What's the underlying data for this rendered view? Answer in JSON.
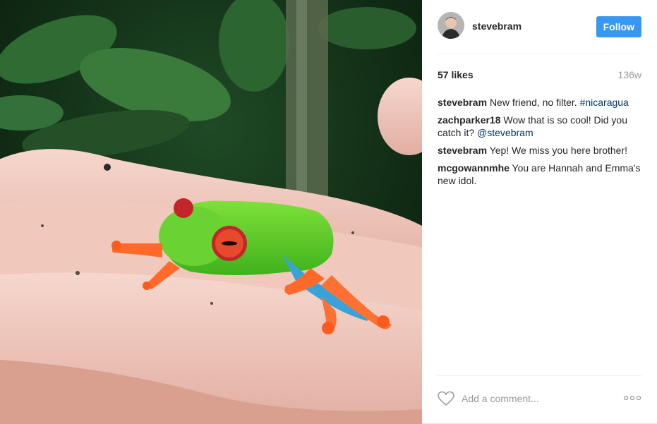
{
  "post": {
    "username": "stevebram",
    "follow_label": "Follow",
    "likes": "57 likes",
    "age": "136w"
  },
  "comments": [
    {
      "user": "stevebram",
      "text": "New friend, no filter. ",
      "link": "#nicaragua"
    },
    {
      "user": "zachparker18",
      "text": "Wow that is so cool! Did you catch it? ",
      "link": "@stevebram"
    },
    {
      "user": "stevebram",
      "text": "Yep! We miss you here brother!",
      "link": ""
    },
    {
      "user": "mcgowannmhe",
      "text": "You are Hannah and Emma's new idol.",
      "link": ""
    }
  ],
  "add_comment": {
    "placeholder": "Add a comment..."
  },
  "icons": {
    "like": "heart-icon",
    "options": "more-options-icon"
  },
  "colors": {
    "follow_button": "#3897f0",
    "link": "#003569",
    "muted": "#999999",
    "text": "#262626"
  }
}
